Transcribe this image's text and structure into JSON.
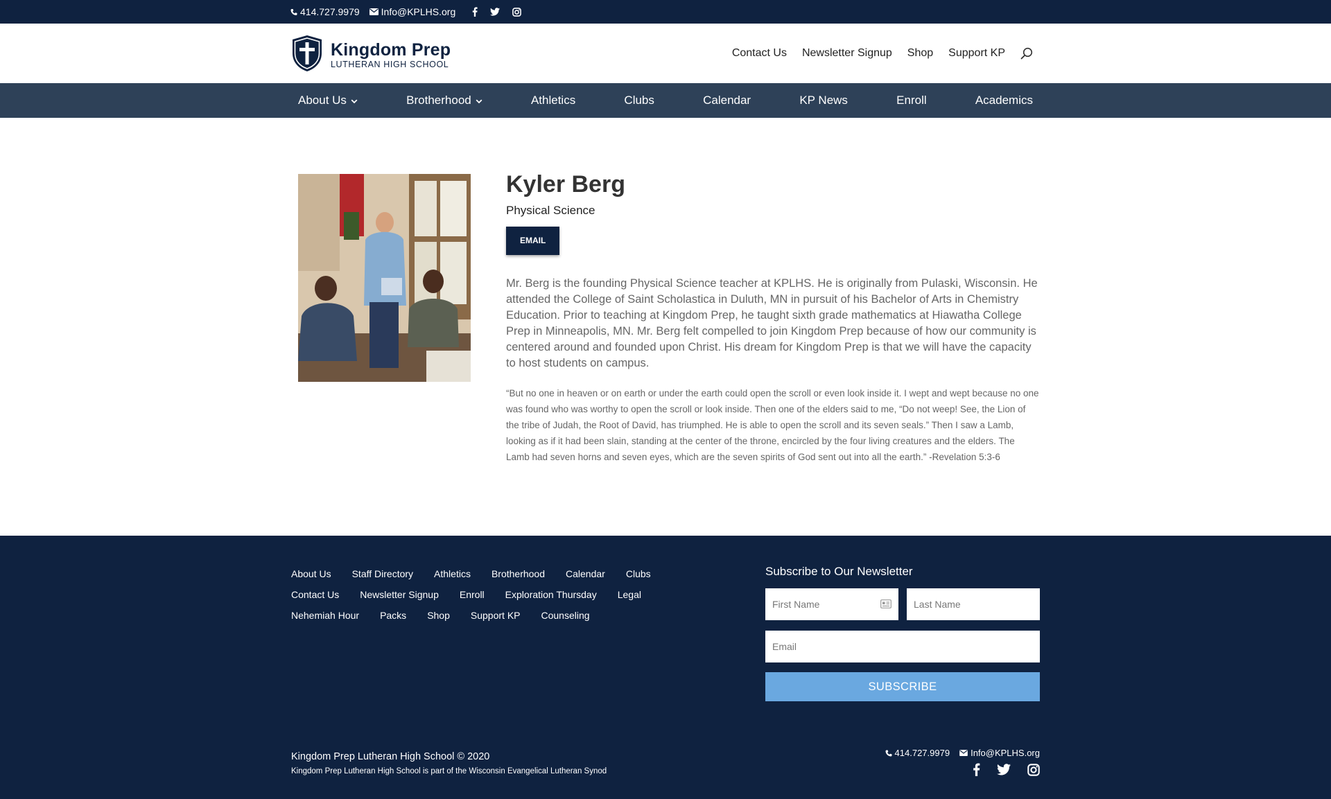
{
  "topbar": {
    "phone": "414.727.9979",
    "email": "Info@KPLHS.org",
    "social": [
      "facebook-icon",
      "twitter-icon",
      "instagram-icon"
    ]
  },
  "header": {
    "logo_title": "Kingdom Prep",
    "logo_subtitle": "LUTHERAN HIGH SCHOOL",
    "util_nav": [
      "Contact Us",
      "Newsletter Signup",
      "Shop",
      "Support KP"
    ]
  },
  "nav": {
    "items": [
      {
        "label": "About Us",
        "dropdown": true
      },
      {
        "label": "Brotherhood",
        "dropdown": true
      },
      {
        "label": "Athletics",
        "dropdown": false
      },
      {
        "label": "Clubs",
        "dropdown": false
      },
      {
        "label": "Calendar",
        "dropdown": false
      },
      {
        "label": "KP News",
        "dropdown": false
      },
      {
        "label": "Enroll",
        "dropdown": false
      },
      {
        "label": "Academics",
        "dropdown": false
      }
    ]
  },
  "profile": {
    "name": "Kyler Berg",
    "subject": "Physical Science",
    "email_button": "EMAIL",
    "bio": "Mr. Berg is the founding Physical Science teacher at KPLHS. He is originally from Pulaski, Wisconsin. He attended the College of Saint Scholastica in Duluth, MN in pursuit of his Bachelor of Arts in Chemistry Education. Prior to teaching at Kingdom Prep, he taught sixth grade mathematics at Hiawatha College Prep in Minneapolis, MN. Mr. Berg felt compelled to join Kingdom Prep because of how our community is centered around and founded upon Christ. His dream for Kingdom Prep is that we will have the capacity to host students on campus.",
    "quote": "“But no one in heaven or on earth or under the earth could open the scroll or even look inside it. I wept and wept because no one was found who was worthy to open the scroll or look inside. Then one of the elders said to me, “Do not weep! See, the Lion of the tribe of Judah, the Root of David, has triumphed. He is able to open the scroll and its seven seals.” Then I saw a Lamb, looking as if it had been slain, standing at the center of the throne, encircled by the four living creatures and the elders. The Lamb had seven horns and seven eyes, which are the seven spirits of God sent out into all the earth.” -Revelation 5:3-6"
  },
  "footer": {
    "links": [
      [
        "About Us",
        "Staff Directory",
        "Athletics",
        "Brotherhood",
        "Calendar",
        "Clubs"
      ],
      [
        "Contact Us",
        "Newsletter Signup",
        "Enroll",
        "Exploration Thursday",
        "Legal"
      ],
      [
        "Nehemiah Hour",
        "Packs",
        "Shop",
        "Support KP",
        "Counseling"
      ]
    ],
    "newsletter": {
      "title": "Subscribe to Our Newsletter",
      "first_name_placeholder": "First Name",
      "last_name_placeholder": "Last Name",
      "email_placeholder": "Email",
      "button": "SUBSCRIBE"
    },
    "copyright": "Kingdom Prep Lutheran High School © 2020",
    "synod": "Kingdom Prep Lutheran High School is part of the Wisconsin Evangelical Lutheran Synod",
    "phone": "414.727.9979",
    "email": "Info@KPLHS.org"
  },
  "colors": {
    "navy": "#0f2240",
    "nav_bar": "#2e4158",
    "subscribe_blue": "#6aa8e0"
  }
}
